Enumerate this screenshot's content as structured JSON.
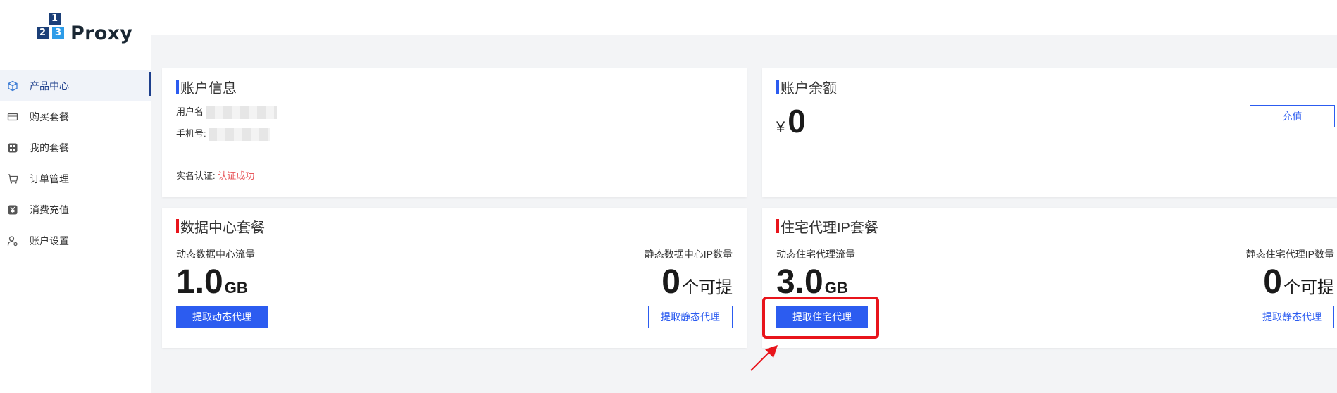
{
  "brand": {
    "logo_digits": [
      "1",
      "2",
      "3"
    ],
    "logo_word": "Proxy"
  },
  "sidebar": {
    "items": [
      {
        "label": "产品中心",
        "icon": "cube-icon",
        "active": true
      },
      {
        "label": "购买套餐",
        "icon": "card-icon",
        "active": false
      },
      {
        "label": "我的套餐",
        "icon": "grid-icon",
        "active": false
      },
      {
        "label": "订单管理",
        "icon": "cart-icon",
        "active": false
      },
      {
        "label": "消费充值",
        "icon": "yen-icon",
        "active": false
      },
      {
        "label": "账户设置",
        "icon": "user-gear-icon",
        "active": false
      }
    ]
  },
  "account_info": {
    "title": "账户信息",
    "username_label": "用户名",
    "phone_label": "手机号:",
    "realname_label": "实名认证:",
    "realname_status": "认证成功"
  },
  "balance": {
    "title": "账户余额",
    "currency": "¥",
    "amount": "0",
    "recharge_label": "充值"
  },
  "datacenter": {
    "title": "数据中心套餐",
    "dynamic_label": "动态数据中心流量",
    "dynamic_value": "1.0",
    "dynamic_unit": "GB",
    "static_label": "静态数据中心IP数量",
    "static_value": "0",
    "static_unit": "个可提",
    "extract_dynamic_label": "提取动态代理",
    "extract_static_label": "提取静态代理"
  },
  "residential": {
    "title": "住宅代理IP套餐",
    "dynamic_label": "动态住宅代理流量",
    "dynamic_value": "3.0",
    "dynamic_unit": "GB",
    "static_label": "静态住宅代理IP数量",
    "static_value": "0",
    "static_unit": "个可提",
    "extract_residential_label": "提取住宅代理",
    "extract_static_label": "提取静态代理"
  },
  "colors": {
    "accent": "#2c5cf0",
    "highlight": "#e8141b",
    "nav_active": "#1e3f8c"
  }
}
